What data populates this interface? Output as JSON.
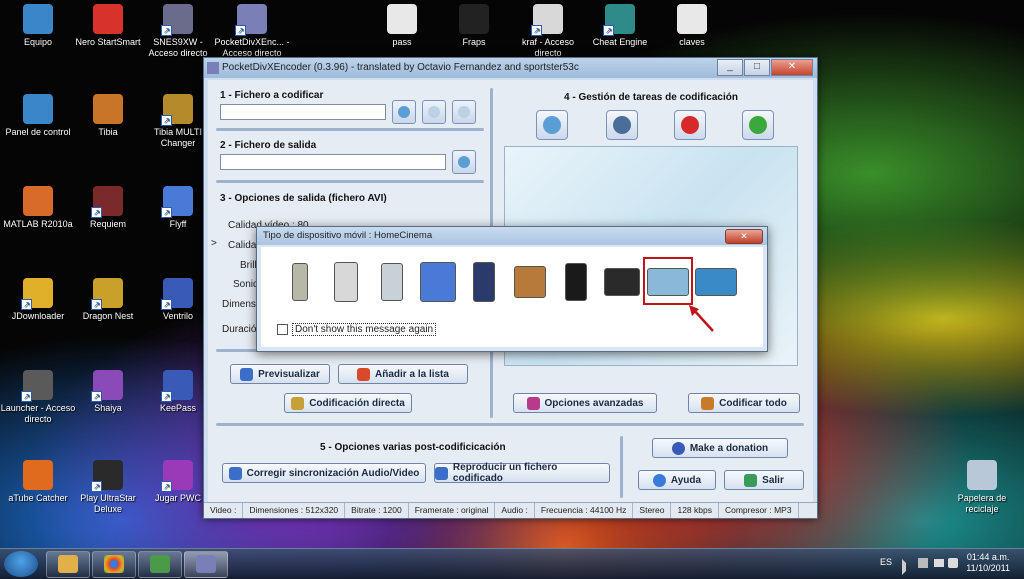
{
  "desktop_icons": [
    {
      "label": "Equipo",
      "color": "#3a86c8"
    },
    {
      "label": "Nero StartSmart",
      "color": "#d8332a"
    },
    {
      "label": "SNES9XW - Acceso directo",
      "color": "#6b6b8c"
    },
    {
      "label": "PocketDivXEnc... - Acceso directo",
      "color": "#7b7fb8"
    },
    {
      "label": "pass",
      "color": "#e8e8e8"
    },
    {
      "label": "Fraps",
      "color": "#222222"
    },
    {
      "label": "kraf - Acceso directo",
      "color": "#d8d8d8"
    },
    {
      "label": "Cheat Engine",
      "color": "#2f8a8a"
    },
    {
      "label": "claves",
      "color": "#e8e8e8"
    },
    {
      "label": "Panel de control",
      "color": "#3a86c8"
    },
    {
      "label": "Tibia",
      "color": "#c8752a"
    },
    {
      "label": "Tibia MULTI Changer",
      "color": "#b58a2a"
    },
    {
      "label": "MATLAB R2010a",
      "color": "#d86a2a"
    },
    {
      "label": "Requiem",
      "color": "#7a2a2a"
    },
    {
      "label": "Flyff",
      "color": "#4a7ad8"
    },
    {
      "label": "JDownloader",
      "color": "#e0b02a"
    },
    {
      "label": "Dragon Nest",
      "color": "#c8a02a"
    },
    {
      "label": "Ventrilo",
      "color": "#3a5ab8"
    },
    {
      "label": "Launcher - Acceso directo",
      "color": "#5a5a5a"
    },
    {
      "label": "Shaiya",
      "color": "#8a4ab8"
    },
    {
      "label": "KeePass",
      "color": "#3a5ab8"
    },
    {
      "label": "aTube Catcher",
      "color": "#e06a1d"
    },
    {
      "label": "Play UltraStar Deluxe",
      "color": "#2a2a2a"
    },
    {
      "label": "Jugar PWC",
      "color": "#9a3ab8"
    },
    {
      "label": "Papelera de reciclaje",
      "color": "#b8c8d8"
    }
  ],
  "window": {
    "title": "PocketDivXEncoder (0.3.96) - translated by Octavio Fernandez and sportster53c",
    "minimize": "_",
    "maximize": "□",
    "close": "✕"
  },
  "sections": {
    "file_to_encode": "1 - Fichero a codificar",
    "output_file": "2 - Fichero de salida",
    "output_options": "3 - Opciones de salida (fichero AVI)",
    "task_management": "4 - Gestión de tareas de codificación",
    "post_options": "5 - Opciones varias post-codificicación"
  },
  "options_labels": {
    "video_quality": "Calidad vídeo",
    "video_quality_value": "80",
    "calidad": "Calidad",
    "brillo": "Brill",
    "sonido": "Sonid",
    "dimension": "Dimensi",
    "duracion": "Duración"
  },
  "buttons": {
    "preview": "Previsualizar",
    "add_to_list": "Añadir a la lista",
    "direct_encoding": "Codificación directa",
    "advanced_options": "Opciones avanzadas",
    "encode_all": "Codificar todo",
    "fix_sync": "Corregir sincronización Audio/Video",
    "play_encoded": "Reproducir un fichero codificado",
    "donation": "Make a donation",
    "help": "Ayuda",
    "exit": "Salir"
  },
  "status_bar": [
    "Video :",
    "Dimensiones : 512x320",
    "Bitrate : 1200",
    "Framerate : original",
    "Audio :",
    "Frecuencia : 44100 Hz",
    "Stereo",
    "128 kbps",
    "Compresor : MP3"
  ],
  "dialog": {
    "title": "Tipo de dispositivo móvil : HomeCinema",
    "close": "✕",
    "checkbox_label": "Don't show this message again",
    "devices": [
      "phone",
      "pda",
      "pda-2",
      "desktop-pc",
      "smartphone",
      "media-player",
      "mp4-player",
      "psp",
      "homecinema-tv",
      "widescreen-tv"
    ],
    "selected_device": "homecinema-tv"
  },
  "taskbar": {
    "language": "ES",
    "time": "01:44 a.m.",
    "date": "11/10/2011"
  }
}
